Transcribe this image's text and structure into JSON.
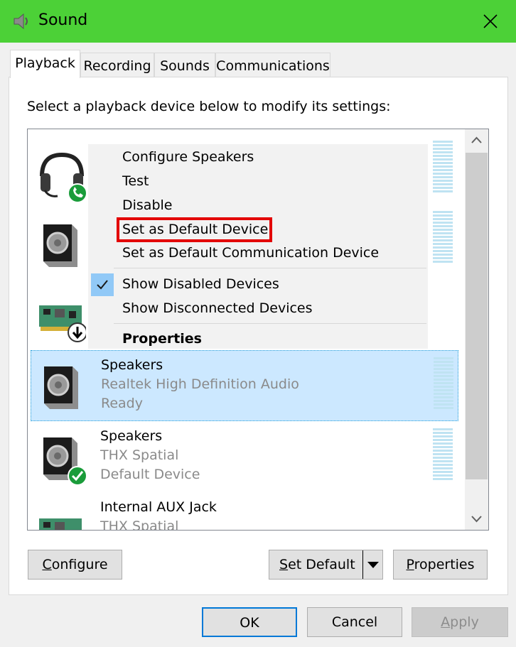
{
  "window": {
    "title": "Sound",
    "icon": "speaker-app-icon"
  },
  "tabs": [
    {
      "label": "Playback",
      "active": true
    },
    {
      "label": "Recording"
    },
    {
      "label": "Sounds"
    },
    {
      "label": "Communications"
    }
  ],
  "instruction": "Select a playback device below to modify its settings:",
  "devices": [
    {
      "name": "Speakers",
      "line1": "Realtek High Definition Audio",
      "line2": "Ready",
      "icon": "speaker-icon",
      "selected": true
    },
    {
      "name": "Speakers",
      "line1": "THX Spatial",
      "line2": "Default Device",
      "icon": "speaker-default-icon"
    },
    {
      "name": "Internal AUX Jack",
      "line1": "THX Spatial",
      "icon": "sound-card-icon"
    }
  ],
  "context_menu": {
    "items": [
      "Configure Speakers",
      "Test",
      "Disable",
      "Set as Default Device",
      "Set as Default Communication Device",
      "Show Disabled Devices",
      "Show Disconnected Devices",
      "Properties"
    ],
    "checked_item": "Show Disabled Devices",
    "highlighted_item": "Set as Default Device"
  },
  "buttons": {
    "configure": {
      "pre": "",
      "accel": "C",
      "post": "onfigure"
    },
    "set_default": {
      "pre": "",
      "accel": "S",
      "post": "et Default"
    },
    "properties": {
      "pre": "",
      "accel": "P",
      "post": "roperties"
    },
    "ok": "OK",
    "cancel": "Cancel",
    "apply": {
      "pre": "",
      "accel": "A",
      "post": "pply"
    }
  },
  "colors": {
    "titlebar": "#4cd137",
    "selection": "#cce8ff",
    "highlight_outline": "#e30000",
    "accent": "#0078d7"
  }
}
